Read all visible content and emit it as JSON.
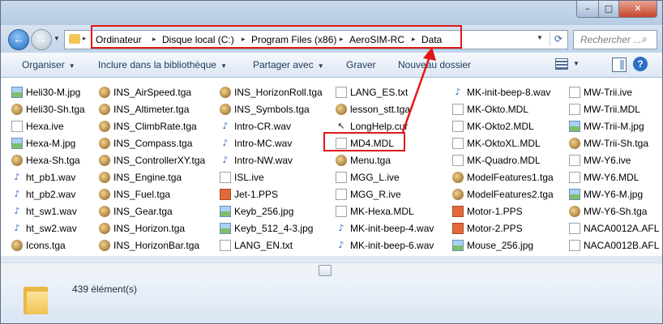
{
  "window": {
    "minimize_glyph": "–",
    "maximize_glyph": "□",
    "close_glyph": "✕"
  },
  "nav": {
    "back_glyph": "←",
    "forward_glyph": "→",
    "breadcrumb": [
      "Ordinateur",
      "Disque local (C:)",
      "Program Files (x86)",
      "AeroSIM-RC",
      "Data"
    ],
    "search_placeholder": "Rechercher ..."
  },
  "toolbar": {
    "organize": "Organiser",
    "include": "Inclure dans la bibliothèque",
    "share": "Partager avec",
    "burn": "Graver",
    "new_folder": "Nouveau dossier"
  },
  "columns": [
    [
      {
        "name": "Heli30-M.jpg",
        "icon": "image-icon"
      },
      {
        "name": "Heli30-Sh.tga",
        "icon": "tga-icon"
      },
      {
        "name": "Hexa.ive",
        "icon": "file-icon"
      },
      {
        "name": "Hexa-M.jpg",
        "icon": "image-icon"
      },
      {
        "name": "Hexa-Sh.tga",
        "icon": "tga-icon"
      },
      {
        "name": "ht_pb1.wav",
        "icon": "audio-icon"
      },
      {
        "name": "ht_pb2.wav",
        "icon": "audio-icon"
      },
      {
        "name": "ht_sw1.wav",
        "icon": "audio-icon"
      },
      {
        "name": "ht_sw2.wav",
        "icon": "audio-icon"
      },
      {
        "name": "Icons.tga",
        "icon": "tga-icon"
      }
    ],
    [
      {
        "name": "INS_AirSpeed.tga",
        "icon": "tga-icon"
      },
      {
        "name": "INS_Altimeter.tga",
        "icon": "tga-icon"
      },
      {
        "name": "INS_ClimbRate.tga",
        "icon": "tga-icon"
      },
      {
        "name": "INS_Compass.tga",
        "icon": "tga-icon"
      },
      {
        "name": "INS_ControllerXY.tga",
        "icon": "tga-icon"
      },
      {
        "name": "INS_Engine.tga",
        "icon": "tga-icon"
      },
      {
        "name": "INS_Fuel.tga",
        "icon": "tga-icon"
      },
      {
        "name": "INS_Gear.tga",
        "icon": "tga-icon"
      },
      {
        "name": "INS_Horizon.tga",
        "icon": "tga-icon"
      },
      {
        "name": "INS_HorizonBar.tga",
        "icon": "tga-icon"
      }
    ],
    [
      {
        "name": "INS_HorizonRoll.tga",
        "icon": "tga-icon"
      },
      {
        "name": "INS_Symbols.tga",
        "icon": "tga-icon"
      },
      {
        "name": "Intro-CR.wav",
        "icon": "audio-icon"
      },
      {
        "name": "Intro-MC.wav",
        "icon": "audio-icon"
      },
      {
        "name": "Intro-NW.wav",
        "icon": "audio-icon"
      },
      {
        "name": "ISL.ive",
        "icon": "file-icon"
      },
      {
        "name": "Jet-1.PPS",
        "icon": "pps-icon"
      },
      {
        "name": "Keyb_256.jpg",
        "icon": "image-icon"
      },
      {
        "name": "Keyb_512_4-3.jpg",
        "icon": "image-icon"
      },
      {
        "name": "LANG_EN.txt",
        "icon": "file-icon"
      }
    ],
    [
      {
        "name": "LANG_ES.txt",
        "icon": "file-icon"
      },
      {
        "name": "lesson_stt.tga",
        "icon": "tga-icon"
      },
      {
        "name": "LongHelp.cur",
        "icon": "cursor-icon"
      },
      {
        "name": "MD4.MDL",
        "icon": "file-icon"
      },
      {
        "name": "Menu.tga",
        "icon": "tga-icon"
      },
      {
        "name": "MGG_L.ive",
        "icon": "file-icon"
      },
      {
        "name": "MGG_R.ive",
        "icon": "file-icon"
      },
      {
        "name": "MK-Hexa.MDL",
        "icon": "file-icon"
      },
      {
        "name": "MK-init-beep-4.wav",
        "icon": "audio-icon"
      },
      {
        "name": "MK-init-beep-6.wav",
        "icon": "audio-icon"
      }
    ],
    [
      {
        "name": "MK-init-beep-8.wav",
        "icon": "audio-icon"
      },
      {
        "name": "MK-Okto.MDL",
        "icon": "file-icon"
      },
      {
        "name": "MK-Okto2.MDL",
        "icon": "file-icon"
      },
      {
        "name": "MK-OktoXL.MDL",
        "icon": "file-icon"
      },
      {
        "name": "MK-Quadro.MDL",
        "icon": "file-icon"
      },
      {
        "name": "ModelFeatures1.tga",
        "icon": "tga-icon"
      },
      {
        "name": "ModelFeatures2.tga",
        "icon": "tga-icon"
      },
      {
        "name": "Motor-1.PPS",
        "icon": "pps-icon"
      },
      {
        "name": "Motor-2.PPS",
        "icon": "pps-icon"
      },
      {
        "name": "Mouse_256.jpg",
        "icon": "image-icon"
      }
    ],
    [
      {
        "name": "MW-Trii.ive",
        "icon": "file-icon"
      },
      {
        "name": "MW-Trii.MDL",
        "icon": "file-icon"
      },
      {
        "name": "MW-Trii-M.jpg",
        "icon": "image-icon"
      },
      {
        "name": "MW-Trii-Sh.tga",
        "icon": "tga-icon"
      },
      {
        "name": "MW-Y6.ive",
        "icon": "file-icon"
      },
      {
        "name": "MW-Y6.MDL",
        "icon": "file-icon"
      },
      {
        "name": "MW-Y6-M.jpg",
        "icon": "image-icon"
      },
      {
        "name": "MW-Y6-Sh.tga",
        "icon": "tga-icon"
      },
      {
        "name": "NACA0012A.AFL",
        "icon": "file-icon"
      },
      {
        "name": "NACA0012B.AFL",
        "icon": "file-icon"
      }
    ]
  ],
  "status": {
    "count_label": "439 élément(s)"
  },
  "colors": {
    "annotation": "#e01818",
    "accent": "#2b6fc6"
  }
}
